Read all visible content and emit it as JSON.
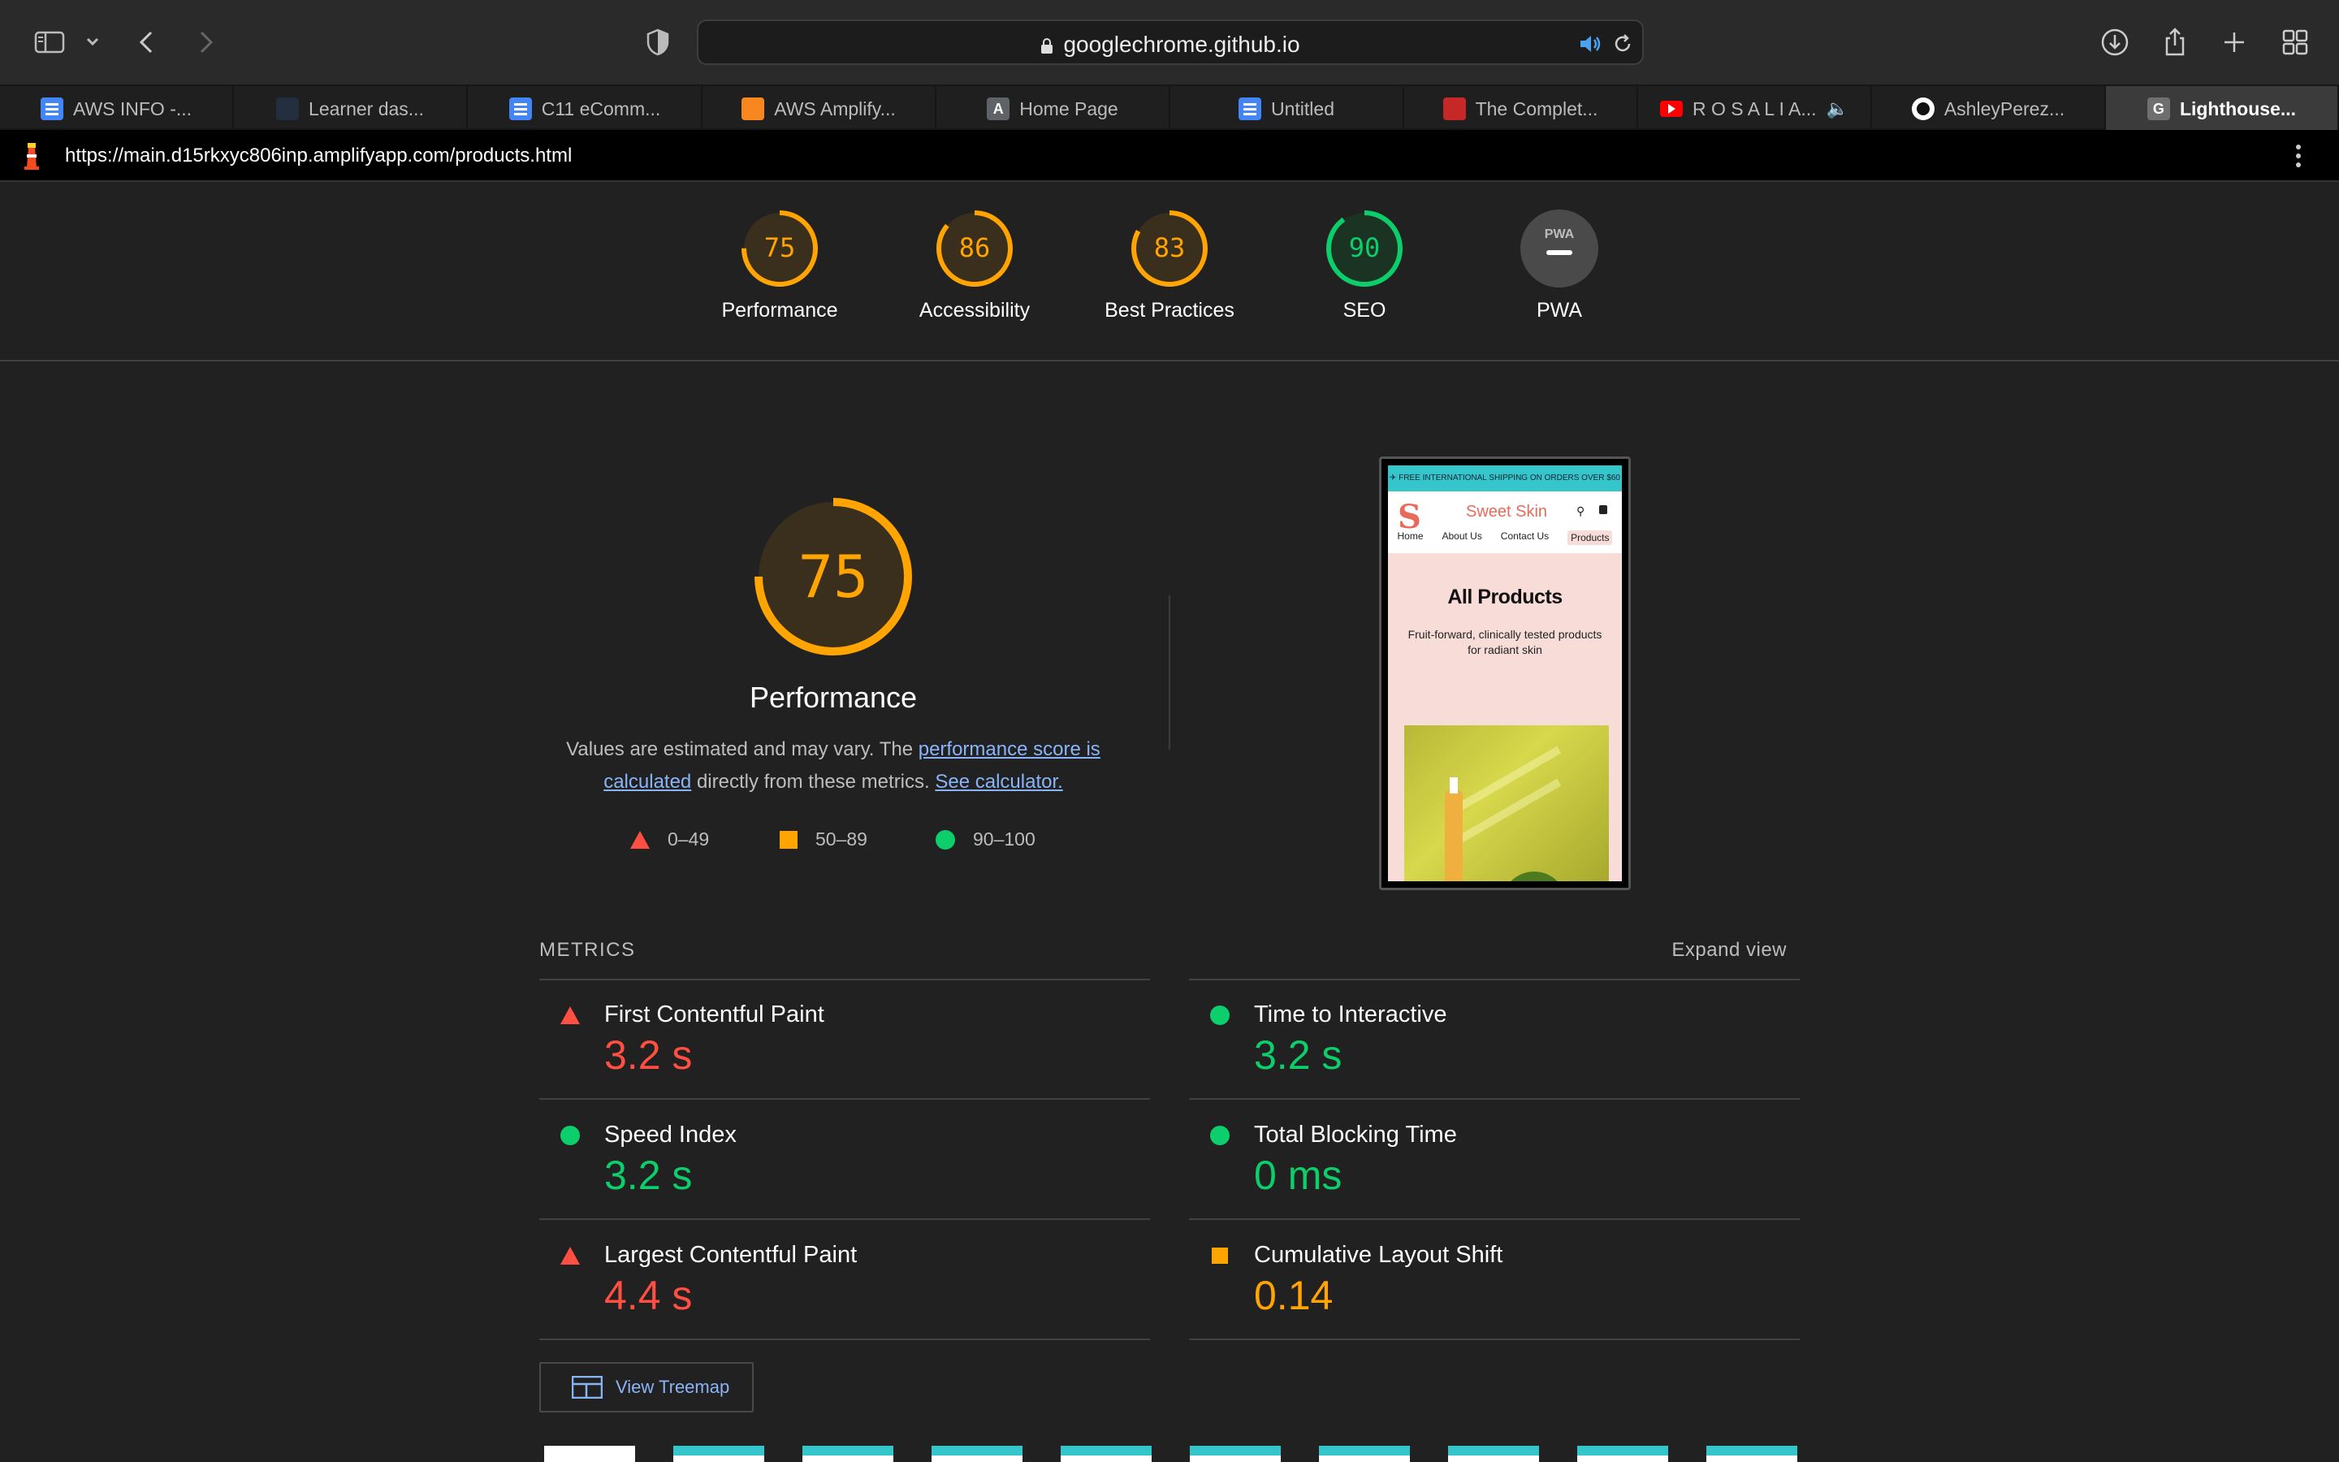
{
  "browser": {
    "address": "googlechrome.github.io",
    "tabs": [
      {
        "label": "AWS INFO -...",
        "favicon": "docs-icon",
        "color": "#4285f4"
      },
      {
        "label": "Learner das...",
        "favicon": "aws-icon",
        "color": "#232f3e"
      },
      {
        "label": "C11 eComm...",
        "favicon": "docs-icon",
        "color": "#4285f4"
      },
      {
        "label": "AWS Amplify...",
        "favicon": "amplify-icon",
        "color": "#f7871e"
      },
      {
        "label": "Home Page",
        "favicon": "letter-a-icon",
        "color": "#5f6368"
      },
      {
        "label": "Untitled",
        "favicon": "docs-icon",
        "color": "#4285f4"
      },
      {
        "label": "The Complet...",
        "favicon": "red-logo-icon",
        "color": "#c62828"
      },
      {
        "label": "R O S A L I A...",
        "favicon": "youtube-icon",
        "color": "#ff0000"
      },
      {
        "label": "AshleyPerez...",
        "favicon": "github-icon",
        "color": "#ffffff"
      },
      {
        "label": "Lighthouse...",
        "favicon": "letter-g-icon",
        "color": "#6f6f6f"
      }
    ]
  },
  "report": {
    "url": "https://main.d15rkxyc806inp.amplifyapp.com/products.html",
    "categories": [
      {
        "score": "75",
        "label": "Performance",
        "value": 0.75,
        "color": "#ffa400"
      },
      {
        "score": "86",
        "label": "Accessibility",
        "value": 0.86,
        "color": "#ffa400"
      },
      {
        "score": "83",
        "label": "Best Practices",
        "value": 0.83,
        "color": "#ffa400"
      },
      {
        "score": "90",
        "label": "SEO",
        "value": 0.9,
        "color": "#0cce6b"
      },
      {
        "score": "PWA",
        "label": "PWA",
        "value": 0,
        "color": "#9e9e9e"
      }
    ],
    "performance": {
      "score": "75",
      "title": "Performance",
      "desc_prefix": "Values are estimated and may vary. The ",
      "desc_link1a": "performance score is",
      "desc_link1b": "calculated",
      "desc_middle": " directly from these metrics. ",
      "desc_link2": "See calculator.",
      "legend": [
        {
          "shape": "triangle",
          "range": "0–49",
          "color": "#ff4e42"
        },
        {
          "shape": "square",
          "range": "50–89",
          "color": "#ffa400"
        },
        {
          "shape": "circle",
          "range": "90–100",
          "color": "#0cce6b"
        }
      ]
    },
    "preview": {
      "banner": "✈ FREE INTERNATIONAL SHIPPING ON ORDERS OVER $60",
      "brand": "Sweet Skin",
      "nav": [
        "Home",
        "About Us",
        "Contact Us",
        "Products"
      ],
      "heading": "All Products",
      "subtext_1": "Fruit-forward, clinically tested products",
      "subtext_2": "for radiant skin"
    },
    "metrics_header": "METRICS",
    "expand_label": "Expand view",
    "metrics": [
      {
        "name": "First Contentful Paint",
        "value": "3.2 s",
        "status": "fail",
        "color": "#ff4e42"
      },
      {
        "name": "Time to Interactive",
        "value": "3.2 s",
        "status": "pass",
        "color": "#0cce6b"
      },
      {
        "name": "Speed Index",
        "value": "3.2 s",
        "status": "pass",
        "color": "#0cce6b"
      },
      {
        "name": "Total Blocking Time",
        "value": "0 ms",
        "status": "pass",
        "color": "#0cce6b"
      },
      {
        "name": "Largest Contentful Paint",
        "value": "4.4 s",
        "status": "fail",
        "color": "#ff4e42"
      },
      {
        "name": "Cumulative Layout Shift",
        "value": "0.14",
        "status": "average",
        "color": "#ffa400"
      }
    ],
    "treemap_label": "View Treemap"
  }
}
